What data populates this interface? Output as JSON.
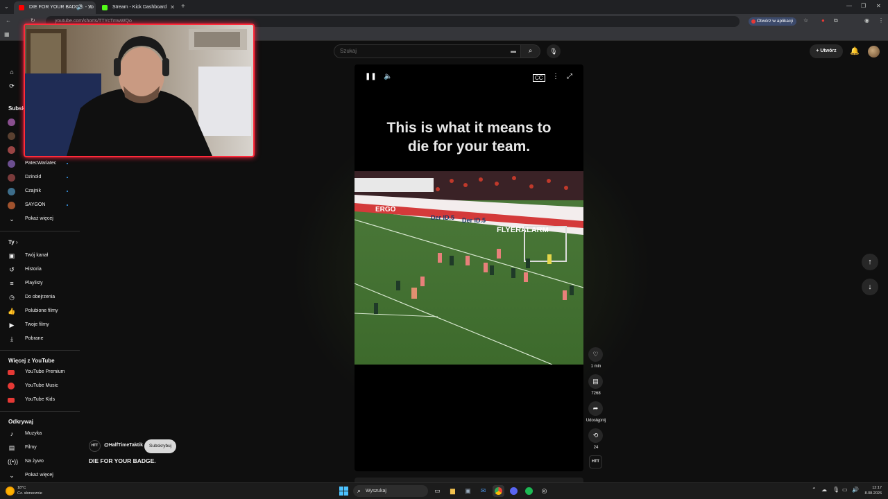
{
  "browser": {
    "tabs": [
      {
        "label": "DIE FOR YOUR BADGE. - Yo",
        "favicon_color": "#ff0000",
        "active": true
      },
      {
        "label": "Stream - Kick Dashboard",
        "favicon_color": "#53fc18",
        "active": false
      }
    ],
    "url": "youtube.com/shorts/TTYcTmwWQo",
    "open_in_app_label": "Otwórz w aplikacji"
  },
  "youtube": {
    "search_placeholder": "Szukaj",
    "create_label": "Utwórz"
  },
  "sidebar": {
    "subscriptions_heading": "Subskrypcje",
    "subscriptions": [
      {
        "name": "PatecWariatec",
        "color": "#6b4e8f"
      },
      {
        "name": "Dzinold",
        "color": "#7a3b3b"
      },
      {
        "name": "Czajnik",
        "color": "#3d6d8a"
      },
      {
        "name": "SAYGON",
        "color": "#a0522d"
      }
    ],
    "show_more_subs": "Pokaż więcej",
    "you_heading": "Ty",
    "you_items": [
      {
        "label": "Twój kanał",
        "icon": "channel-icon"
      },
      {
        "label": "Historia",
        "icon": "history-icon"
      },
      {
        "label": "Playlisty",
        "icon": "playlist-icon"
      },
      {
        "label": "Do obejrzenia",
        "icon": "watch-later-icon"
      },
      {
        "label": "Polubione filmy",
        "icon": "like-icon"
      },
      {
        "label": "Twoje filmy",
        "icon": "your-videos-icon"
      },
      {
        "label": "Pobrane",
        "icon": "download-icon"
      }
    ],
    "more_heading": "Więcej z YouTube",
    "more_items": [
      {
        "label": "YouTube Premium",
        "icon": "youtube-premium-icon"
      },
      {
        "label": "YouTube Music",
        "icon": "youtube-music-icon"
      },
      {
        "label": "YouTube Kids",
        "icon": "youtube-kids-icon"
      }
    ],
    "explore_heading": "Odkrywaj",
    "explore_items": [
      {
        "label": "Muzyka",
        "icon": "music-icon"
      },
      {
        "label": "Filmy",
        "icon": "movies-icon"
      },
      {
        "label": "Na żywo",
        "icon": "live-icon"
      },
      {
        "label": "Pokaż więcej",
        "icon": "chevron-down-icon"
      }
    ]
  },
  "short": {
    "caption": "This is what it means to die for your team.",
    "channel_handle": "@HalfTimeTaktik",
    "channel_badge": "HTT",
    "subscribe_label": "Subskrybuj",
    "title": "DIE FOR YOUR BADGE.",
    "likes_label": "1 mln",
    "comments_label": "7268",
    "share_label": "Udostępnij",
    "remix_label": "24",
    "ad_boards": [
      "ERGO",
      "Der ID.5",
      "Der ID.5",
      "FLYERALARM"
    ]
  },
  "taskbar": {
    "weather_temp": "18°C",
    "weather_desc": "Cz. słonecznie",
    "search_label": "Wyszukaj",
    "time": "12:17",
    "date": "8.08.2026"
  }
}
